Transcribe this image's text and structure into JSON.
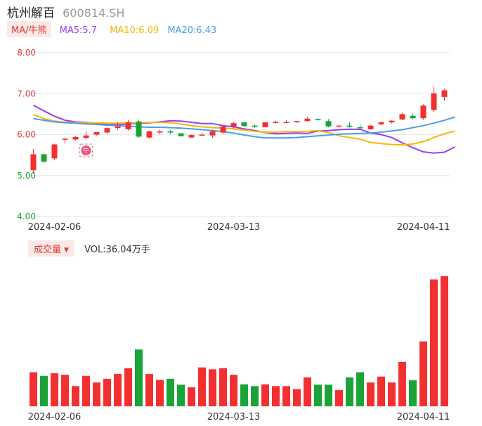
{
  "header": {
    "name": "杭州解百",
    "code": "600814.SH"
  },
  "legend": {
    "ma_select_label": "MA/牛熊",
    "ma5": "MA5:5.7",
    "ma10": "MA10:6.09",
    "ma20": "MA20:6.43"
  },
  "volume_legend": {
    "select_label": "成交量",
    "value": "VOL:36.04万手"
  },
  "badge": {
    "text": "牛"
  },
  "colors": {
    "up": "#f23030",
    "down": "#1aa336",
    "ma5": "#9b3df0",
    "ma10": "#f5b800",
    "ma20": "#4b9ee8",
    "grid": "#e6e6e6",
    "axis_text_price": "#e53935",
    "axis_text_low": "#1aa336",
    "axis_text_date": "#333333"
  },
  "chart_data": [
    {
      "type": "candlestick",
      "title": "",
      "ylim": [
        4.0,
        8.0
      ],
      "y_ticks": [
        "8.00",
        "7.00",
        "6.00",
        "5.00",
        "4.00"
      ],
      "x_tick_labels": [
        {
          "label": "2024-02-06",
          "index": 2
        },
        {
          "label": "2024-03-13",
          "index": 19
        },
        {
          "label": "2024-04-11",
          "index": 37
        }
      ],
      "ohlc": [
        {
          "o": 5.13,
          "h": 5.65,
          "l": 5.05,
          "c": 5.52
        },
        {
          "o": 5.52,
          "h": 5.55,
          "l": 5.31,
          "c": 5.34
        },
        {
          "o": 5.42,
          "h": 5.78,
          "l": 5.38,
          "c": 5.76
        },
        {
          "o": 5.88,
          "h": 5.92,
          "l": 5.78,
          "c": 5.9
        },
        {
          "o": 5.88,
          "h": 5.96,
          "l": 5.86,
          "c": 5.94
        },
        {
          "o": 5.92,
          "h": 6.08,
          "l": 5.88,
          "c": 5.98
        },
        {
          "o": 6.0,
          "h": 6.06,
          "l": 5.98,
          "c": 6.06
        },
        {
          "o": 6.05,
          "h": 6.18,
          "l": 6.02,
          "c": 6.16
        },
        {
          "o": 6.16,
          "h": 6.3,
          "l": 6.12,
          "c": 6.2
        },
        {
          "o": 6.13,
          "h": 6.36,
          "l": 6.1,
          "c": 6.3
        },
        {
          "o": 6.32,
          "h": 6.37,
          "l": 5.92,
          "c": 5.95
        },
        {
          "o": 5.93,
          "h": 6.1,
          "l": 5.9,
          "c": 6.08
        },
        {
          "o": 6.05,
          "h": 6.12,
          "l": 6.02,
          "c": 6.08
        },
        {
          "o": 6.08,
          "h": 6.12,
          "l": 6.02,
          "c": 6.05
        },
        {
          "o": 6.03,
          "h": 6.05,
          "l": 5.95,
          "c": 5.96
        },
        {
          "o": 5.93,
          "h": 6.0,
          "l": 5.92,
          "c": 5.99
        },
        {
          "o": 6.0,
          "h": 6.05,
          "l": 5.98,
          "c": 6.0
        },
        {
          "o": 5.98,
          "h": 6.12,
          "l": 5.92,
          "c": 6.08
        },
        {
          "o": 6.05,
          "h": 6.22,
          "l": 6.02,
          "c": 6.2
        },
        {
          "o": 6.2,
          "h": 6.3,
          "l": 6.15,
          "c": 6.28
        },
        {
          "o": 6.3,
          "h": 6.3,
          "l": 6.18,
          "c": 6.21
        },
        {
          "o": 6.22,
          "h": 6.25,
          "l": 6.17,
          "c": 6.19
        },
        {
          "o": 6.18,
          "h": 6.3,
          "l": 6.18,
          "c": 6.3
        },
        {
          "o": 6.29,
          "h": 6.34,
          "l": 6.27,
          "c": 6.31
        },
        {
          "o": 6.3,
          "h": 6.35,
          "l": 6.28,
          "c": 6.31
        },
        {
          "o": 6.3,
          "h": 6.34,
          "l": 6.29,
          "c": 6.33
        },
        {
          "o": 6.33,
          "h": 6.43,
          "l": 6.32,
          "c": 6.39
        },
        {
          "o": 6.38,
          "h": 6.4,
          "l": 6.34,
          "c": 6.36
        },
        {
          "o": 6.33,
          "h": 6.38,
          "l": 6.18,
          "c": 6.2
        },
        {
          "o": 6.2,
          "h": 6.24,
          "l": 6.17,
          "c": 6.22
        },
        {
          "o": 6.22,
          "h": 6.3,
          "l": 6.17,
          "c": 6.19
        },
        {
          "o": 6.18,
          "h": 6.24,
          "l": 6.13,
          "c": 6.16
        },
        {
          "o": 6.13,
          "h": 6.24,
          "l": 6.12,
          "c": 6.22
        },
        {
          "o": 6.25,
          "h": 6.31,
          "l": 6.23,
          "c": 6.3
        },
        {
          "o": 6.3,
          "h": 6.35,
          "l": 6.27,
          "c": 6.34
        },
        {
          "o": 6.37,
          "h": 6.53,
          "l": 6.35,
          "c": 6.5
        },
        {
          "o": 6.46,
          "h": 6.52,
          "l": 6.37,
          "c": 6.4
        },
        {
          "o": 6.4,
          "h": 6.74,
          "l": 6.36,
          "c": 6.71
        },
        {
          "o": 6.6,
          "h": 7.17,
          "l": 6.55,
          "c": 7.01
        },
        {
          "o": 6.92,
          "h": 7.12,
          "l": 6.83,
          "c": 7.08
        }
      ],
      "series": [
        {
          "name": "MA5",
          "values": [
            6.72,
            6.58,
            6.45,
            6.35,
            6.31,
            6.3,
            6.27,
            6.25,
            6.24,
            6.26,
            6.27,
            6.29,
            6.31,
            6.34,
            6.33,
            6.3,
            6.27,
            6.27,
            6.22,
            6.19,
            6.14,
            6.1,
            6.05,
            6.02,
            6.03,
            6.04,
            6.03,
            6.09,
            6.1,
            6.12,
            6.13,
            6.13,
            6.04,
            6.0,
            5.93,
            5.8,
            5.68,
            5.58,
            5.55,
            5.57,
            5.7
          ]
        },
        {
          "name": "MA10",
          "values": [
            6.49,
            6.39,
            6.33,
            6.3,
            6.3,
            6.29,
            6.29,
            6.28,
            6.28,
            6.28,
            6.29,
            6.3,
            6.3,
            6.29,
            6.26,
            6.22,
            6.19,
            6.17,
            6.16,
            6.14,
            6.11,
            6.08,
            6.06,
            6.06,
            6.07,
            6.07,
            6.08,
            6.1,
            6.05,
            5.97,
            5.93,
            5.89,
            5.81,
            5.78,
            5.76,
            5.75,
            5.77,
            5.83,
            5.93,
            6.02,
            6.09
          ]
        },
        {
          "name": "MA20",
          "values": [
            6.39,
            6.35,
            6.31,
            6.29,
            6.28,
            6.26,
            6.25,
            6.23,
            6.22,
            6.2,
            6.19,
            6.18,
            6.18,
            6.17,
            6.16,
            6.14,
            6.12,
            6.1,
            6.07,
            6.04,
            5.99,
            5.95,
            5.92,
            5.92,
            5.92,
            5.93,
            5.95,
            5.97,
            5.99,
            6.01,
            6.02,
            6.03,
            6.04,
            6.06,
            6.09,
            6.12,
            6.17,
            6.22,
            6.28,
            6.35,
            6.43
          ]
        }
      ]
    },
    {
      "type": "bar",
      "title": "",
      "ylabel": "",
      "ylim": [
        0,
        36.04
      ],
      "x_tick_labels": [
        {
          "label": "2024-02-06",
          "index": 2
        },
        {
          "label": "2024-03-13",
          "index": 19
        },
        {
          "label": "2024-04-11",
          "index": 37
        }
      ],
      "values": [
        9.3,
        8.3,
        9.0,
        8.6,
        5.5,
        8.3,
        6.5,
        7.5,
        8.8,
        10.4,
        15.5,
        8.8,
        7.2,
        7.5,
        5.9,
        5.2,
        10.6,
        10.1,
        10.4,
        8.6,
        6.0,
        5.5,
        6.0,
        5.5,
        5.5,
        4.7,
        7.9,
        5.9,
        5.9,
        4.4,
        7.9,
        9.3,
        6.5,
        8.1,
        6.5,
        12.1,
        7.1,
        17.7,
        34.6,
        35.5
      ]
    }
  ]
}
